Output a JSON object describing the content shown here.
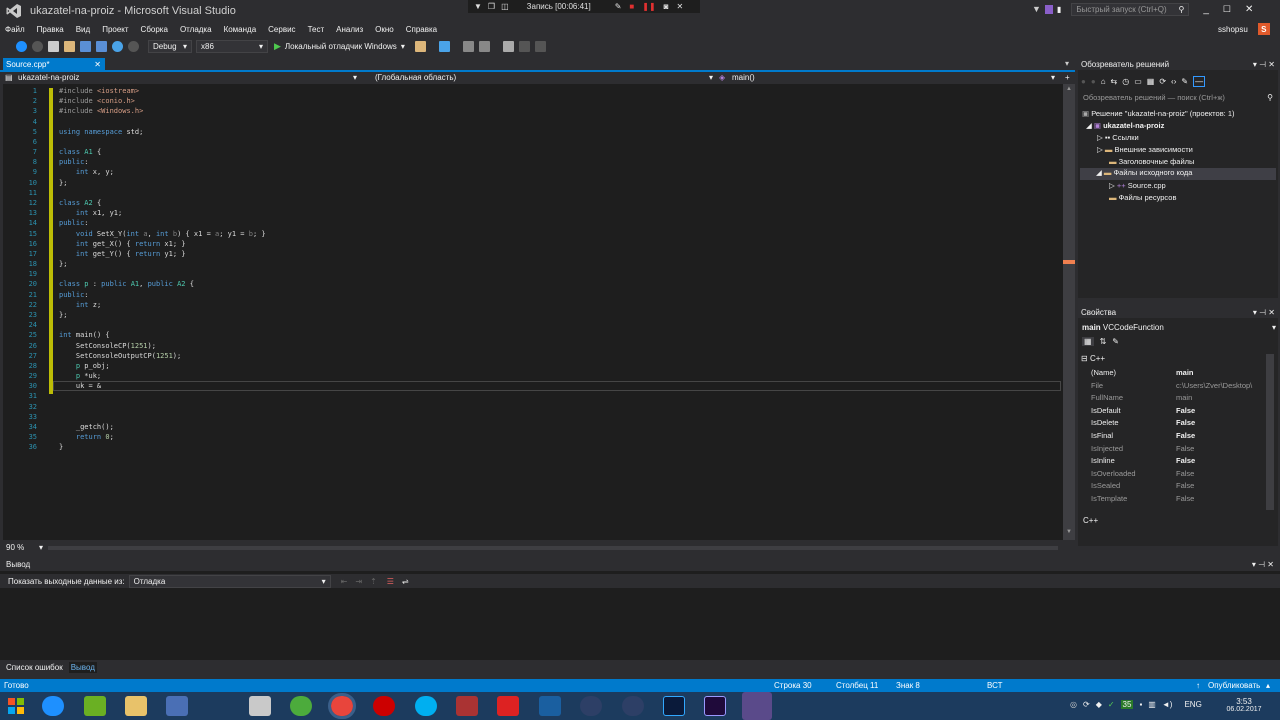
{
  "window": {
    "title": "ukazatel-na-proiz - Microsoft Visual Studio"
  },
  "recorder": {
    "label": "Запись [00:06:41]"
  },
  "quick_launch": {
    "placeholder": "Быстрый запуск (Ctrl+Q)"
  },
  "user": {
    "name": "sshopsu",
    "avatar_letter": "S"
  },
  "menu": [
    "Файл",
    "Правка",
    "Вид",
    "Проект",
    "Сборка",
    "Отладка",
    "Команда",
    "Сервис",
    "Тест",
    "Анализ",
    "Окно",
    "Справка"
  ],
  "toolbar": {
    "config": "Debug",
    "platform": "x86",
    "run_label": "Локальный отладчик Windows"
  },
  "editor": {
    "tab": "Source.cpp*",
    "nav_project": "ukazatel-na-proiz",
    "nav_scope": "(Глобальная область)",
    "nav_member": "main()",
    "zoom": "90 %",
    "lines": [
      {
        "n": "1",
        "t": [
          [
            "pp",
            "#include "
          ],
          [
            "str",
            "<iostream>"
          ]
        ]
      },
      {
        "n": "2",
        "t": [
          [
            "pp",
            "#include "
          ],
          [
            "str",
            "<conio.h>"
          ]
        ]
      },
      {
        "n": "3",
        "t": [
          [
            "pp",
            "#include "
          ],
          [
            "str",
            "<Windows.h>"
          ]
        ]
      },
      {
        "n": "4",
        "t": []
      },
      {
        "n": "5",
        "t": [
          [
            "kw",
            "using namespace "
          ],
          [
            "",
            "std;"
          ]
        ]
      },
      {
        "n": "6",
        "t": []
      },
      {
        "n": "7",
        "t": [
          [
            "kw",
            "class "
          ],
          [
            "cls",
            "A1"
          ],
          [
            "",
            " {"
          ]
        ]
      },
      {
        "n": "8",
        "t": [
          [
            "kw",
            "public"
          ],
          [
            "",
            ":"
          ]
        ]
      },
      {
        "n": "9",
        "t": [
          [
            "",
            "    "
          ],
          [
            "kw",
            "int"
          ],
          [
            "",
            " x, y;"
          ]
        ]
      },
      {
        "n": "10",
        "t": [
          [
            "",
            "};"
          ]
        ]
      },
      {
        "n": "11",
        "t": []
      },
      {
        "n": "12",
        "t": [
          [
            "kw",
            "class "
          ],
          [
            "cls",
            "A2"
          ],
          [
            "",
            " {"
          ]
        ]
      },
      {
        "n": "13",
        "t": [
          [
            "",
            "    "
          ],
          [
            "kw",
            "int"
          ],
          [
            "",
            " x1, y1;"
          ]
        ]
      },
      {
        "n": "14",
        "t": [
          [
            "kw",
            "public"
          ],
          [
            "",
            ":"
          ]
        ]
      },
      {
        "n": "15",
        "t": [
          [
            "",
            "    "
          ],
          [
            "kw",
            "void"
          ],
          [
            "",
            " SetX_Y("
          ],
          [
            "kw",
            "int"
          ],
          [
            "",
            " "
          ],
          [
            "par",
            "a"
          ],
          [
            "",
            ", "
          ],
          [
            "kw",
            "int"
          ],
          [
            "",
            " "
          ],
          [
            "par",
            "b"
          ],
          [
            "",
            ") { x1 = "
          ],
          [
            "par",
            "a"
          ],
          [
            "",
            "; y1 = "
          ],
          [
            "par",
            "b"
          ],
          [
            "",
            "; }"
          ]
        ]
      },
      {
        "n": "16",
        "t": [
          [
            "",
            "    "
          ],
          [
            "kw",
            "int"
          ],
          [
            "",
            " get_X() { "
          ],
          [
            "kw",
            "return"
          ],
          [
            "",
            " x1; }"
          ]
        ]
      },
      {
        "n": "17",
        "t": [
          [
            "",
            "    "
          ],
          [
            "kw",
            "int"
          ],
          [
            "",
            " get_Y() { "
          ],
          [
            "kw",
            "return"
          ],
          [
            "",
            " y1; }"
          ]
        ]
      },
      {
        "n": "18",
        "t": [
          [
            "",
            "};"
          ]
        ]
      },
      {
        "n": "19",
        "t": []
      },
      {
        "n": "20",
        "t": [
          [
            "kw",
            "class "
          ],
          [
            "cls",
            "p"
          ],
          [
            "",
            " : "
          ],
          [
            "kw",
            "public "
          ],
          [
            "cls",
            "A1"
          ],
          [
            "",
            ", "
          ],
          [
            "kw",
            "public "
          ],
          [
            "cls",
            "A2"
          ],
          [
            "",
            " {"
          ]
        ]
      },
      {
        "n": "21",
        "t": [
          [
            "kw",
            "public"
          ],
          [
            "",
            ":"
          ]
        ]
      },
      {
        "n": "22",
        "t": [
          [
            "",
            "    "
          ],
          [
            "kw",
            "int"
          ],
          [
            "",
            " z;"
          ]
        ]
      },
      {
        "n": "23",
        "t": [
          [
            "",
            "};"
          ]
        ]
      },
      {
        "n": "24",
        "t": []
      },
      {
        "n": "25",
        "t": [
          [
            "kw",
            "int"
          ],
          [
            "",
            " main() {"
          ]
        ]
      },
      {
        "n": "26",
        "t": [
          [
            "",
            "    SetConsoleCP("
          ],
          [
            "num",
            "1251"
          ],
          [
            "",
            ");"
          ]
        ]
      },
      {
        "n": "27",
        "t": [
          [
            "",
            "    SetConsoleOutputCP("
          ],
          [
            "num",
            "1251"
          ],
          [
            "",
            ");"
          ]
        ]
      },
      {
        "n": "28",
        "t": [
          [
            "",
            "    "
          ],
          [
            "cls",
            "p"
          ],
          [
            "",
            " p_obj;"
          ]
        ]
      },
      {
        "n": "29",
        "t": [
          [
            "",
            "    "
          ],
          [
            "cls",
            "p"
          ],
          [
            "",
            " *uk;"
          ]
        ]
      },
      {
        "n": "30",
        "t": [
          [
            "",
            "    uk = &"
          ]
        ]
      },
      {
        "n": "31",
        "t": []
      },
      {
        "n": "32",
        "t": []
      },
      {
        "n": "33",
        "t": []
      },
      {
        "n": "34",
        "t": [
          [
            "",
            "    _getch();"
          ]
        ]
      },
      {
        "n": "35",
        "t": [
          [
            "",
            "    "
          ],
          [
            "kw",
            "return"
          ],
          [
            "",
            " "
          ],
          [
            "num",
            "0"
          ],
          [
            "",
            ";"
          ]
        ]
      },
      {
        "n": "36",
        "t": [
          [
            "",
            "}"
          ]
        ]
      }
    ]
  },
  "solution_explorer": {
    "title": "Обозреватель решений",
    "search_placeholder": "Обозреватель решений — поиск (Ctrl+ж)",
    "items": [
      {
        "label": "Решение \"ukazatel-na-proiz\" (проектов: 1)",
        "bold": false
      },
      {
        "label": "ukazatel-na-proiz",
        "bold": true
      },
      {
        "label": "Ссылки",
        "bold": false
      },
      {
        "label": "Внешние зависимости",
        "bold": false
      },
      {
        "label": "Заголовочные файлы",
        "bold": false
      },
      {
        "label": "Файлы исходного кода",
        "bold": false
      },
      {
        "label": "Source.cpp",
        "bold": false
      },
      {
        "label": "Файлы ресурсов",
        "bold": false
      }
    ]
  },
  "properties": {
    "title": "Свойства",
    "object_name": "main",
    "object_type": "VCCodeFunction",
    "category": "C++",
    "footer": "C++",
    "rows": [
      {
        "name": "(Name)",
        "value": "main",
        "dim": false
      },
      {
        "name": "File",
        "value": "c:\\Users\\Zver\\Desktop\\",
        "dim": true
      },
      {
        "name": "FullName",
        "value": "main",
        "dim": true
      },
      {
        "name": "IsDefault",
        "value": "False",
        "dim": false
      },
      {
        "name": "IsDelete",
        "value": "False",
        "dim": false
      },
      {
        "name": "IsFinal",
        "value": "False",
        "dim": false
      },
      {
        "name": "IsInjected",
        "value": "False",
        "dim": true
      },
      {
        "name": "IsInline",
        "value": "False",
        "dim": false
      },
      {
        "name": "IsOverloaded",
        "value": "False",
        "dim": true
      },
      {
        "name": "IsSealed",
        "value": "False",
        "dim": true
      },
      {
        "name": "IsTemplate",
        "value": "False",
        "dim": true
      }
    ]
  },
  "output": {
    "title": "Вывод",
    "show_label": "Показать выходные данные из:",
    "source": "Отладка"
  },
  "bottom_tabs": [
    "Список ошибок",
    "Вывод"
  ],
  "status": {
    "ready": "Готово",
    "line": "Строка 30",
    "col": "Столбец 11",
    "ch": "Знак 8",
    "mode": "ВСТ",
    "publish": "Опубликовать"
  },
  "taskbar": {
    "lang": "ENG",
    "time": "3:53",
    "date": "06.02.2017",
    "badge": "35"
  },
  "colors": {
    "accent": "#007acc",
    "editor_bg": "#1e1e1e",
    "chrome": "#2d2d30"
  }
}
